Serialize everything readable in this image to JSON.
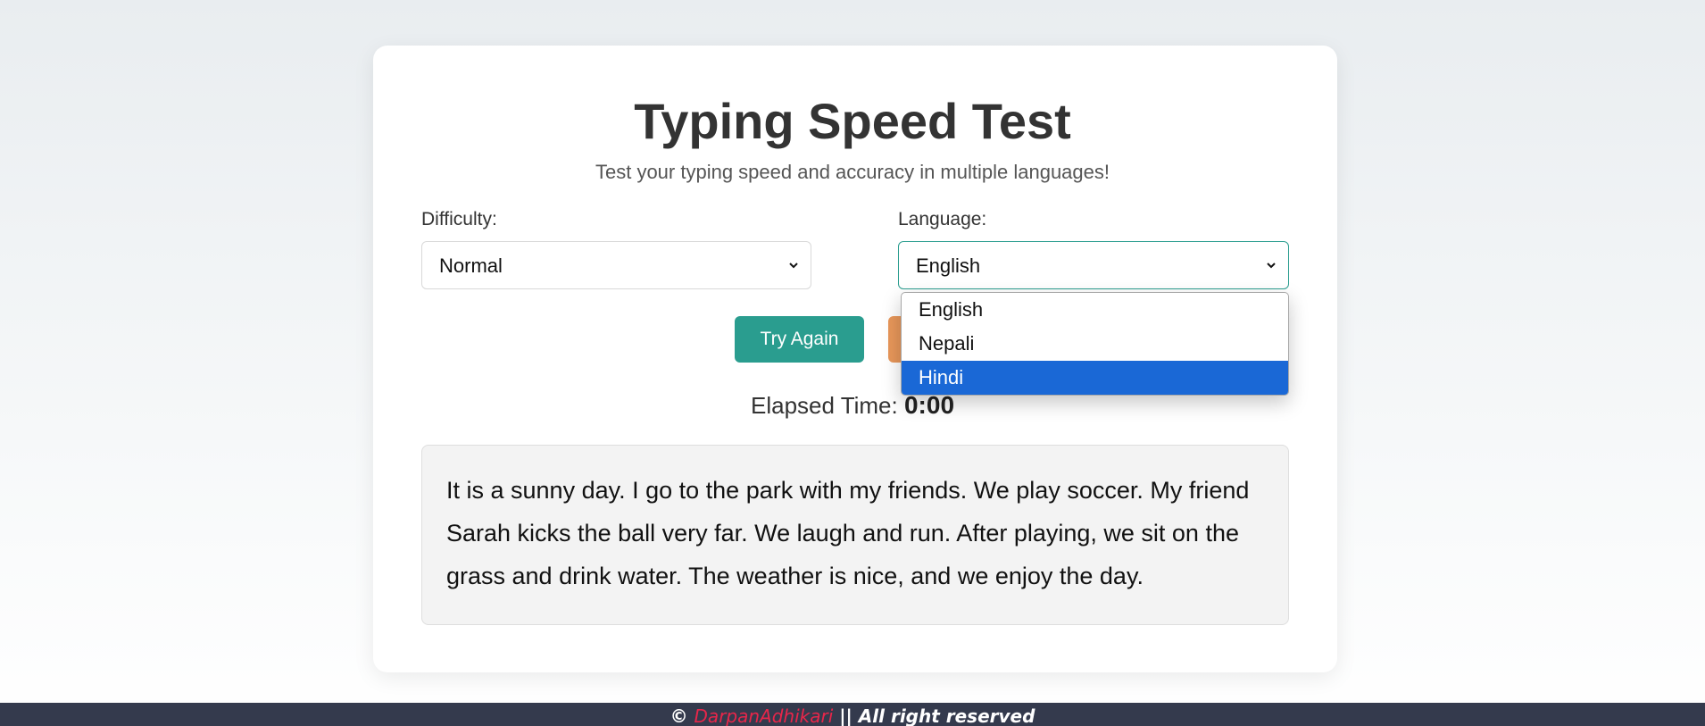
{
  "app": {
    "title": "Typing Speed Test",
    "subtitle": "Test your typing speed and accuracy in multiple languages!"
  },
  "difficulty": {
    "label": "Difficulty:",
    "selected": "Normal"
  },
  "language": {
    "label": "Language:",
    "selected": "English",
    "options": [
      "English",
      "Nepali",
      "Hindi"
    ],
    "highlighted": "Hindi"
  },
  "buttons": {
    "try_again": "Try Again"
  },
  "timer": {
    "label": "Elapsed Time:",
    "value": "0:00"
  },
  "passage": {
    "text": "It is a sunny day. I go to the park with my friends. We play soccer. My friend Sarah kicks the ball very far. We laugh and run. After playing, we sit on the grass and drink water. The weather is nice, and we enjoy the day."
  },
  "footer": {
    "copyright": "©",
    "author": "DarpanAdhikari",
    "rights": "|| All right reserved"
  },
  "colors": {
    "primary": "#2a9d8f",
    "secondary": "#e8975a",
    "highlight": "#1a68d6",
    "footer_bg": "#343a4d",
    "author": "#e8264a"
  },
  "icons": {
    "select_arrow": "chevron-down-icon"
  }
}
